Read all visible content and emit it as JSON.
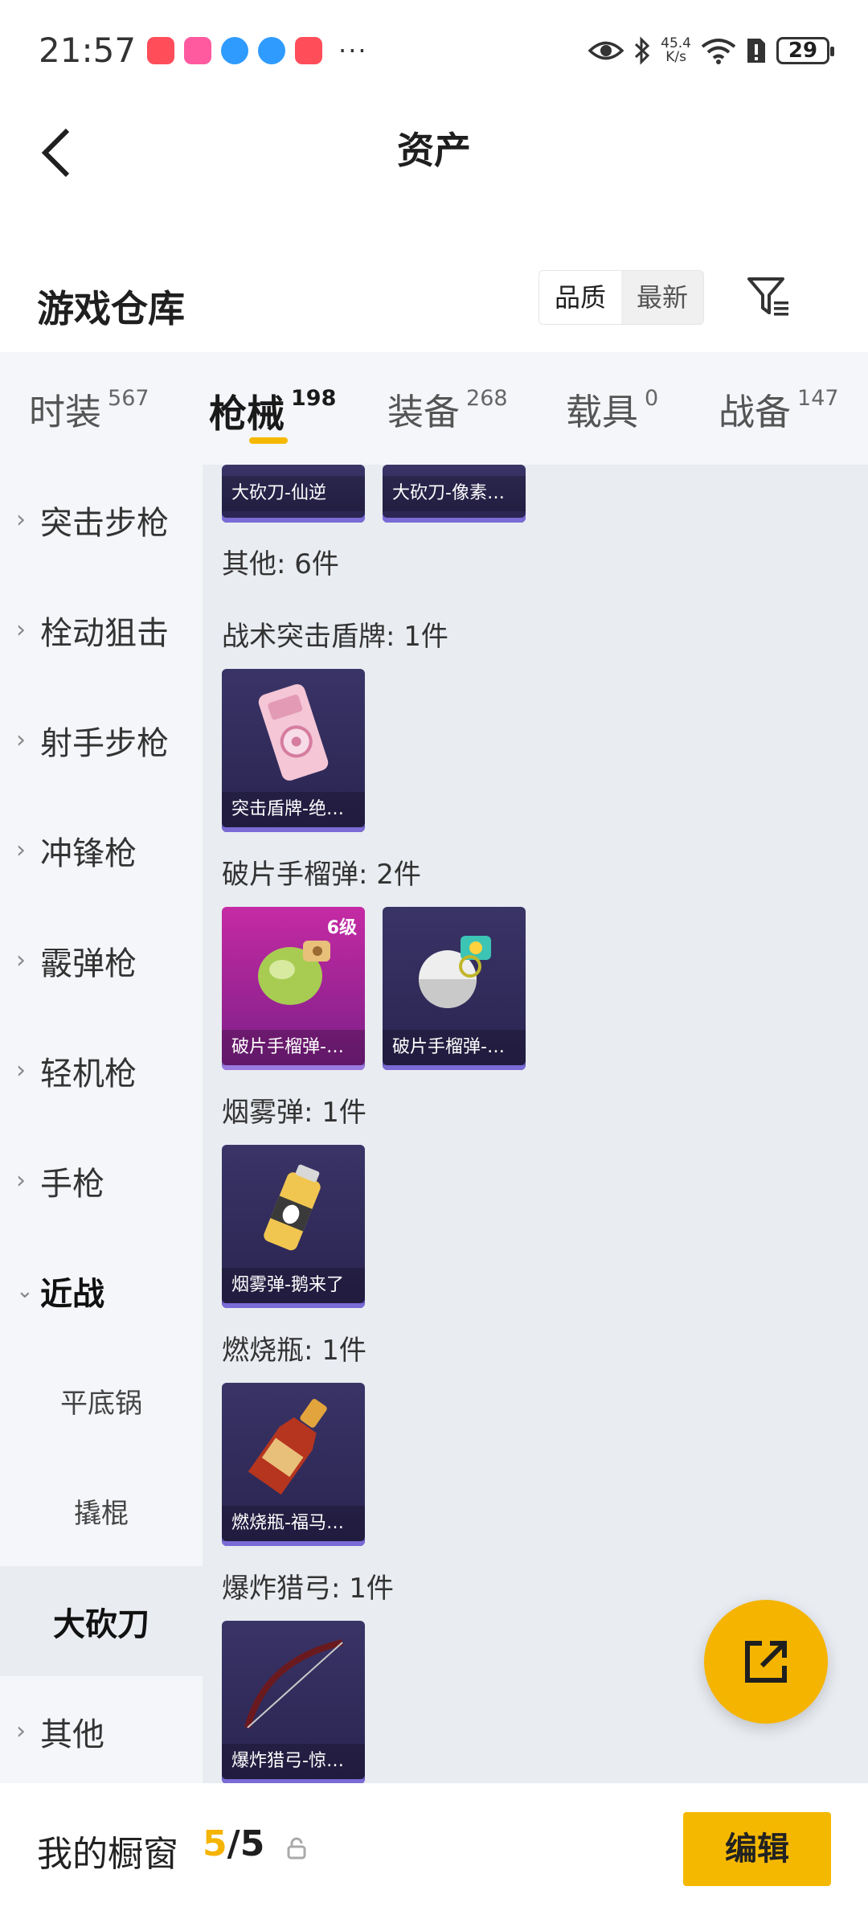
{
  "status_bar": {
    "time": "21:57",
    "net_speed_value": "45.4",
    "net_speed_unit": "K/s",
    "battery": "29"
  },
  "header": {
    "title": "资产"
  },
  "warehouse": {
    "title": "游戏仓库",
    "sort_options": [
      "品质",
      "最新"
    ],
    "sort_selected": "品质"
  },
  "tabs": [
    {
      "label": "时装",
      "count": "567"
    },
    {
      "label": "枪械",
      "count": "198",
      "active": true
    },
    {
      "label": "装备",
      "count": "268"
    },
    {
      "label": "载具",
      "count": "0"
    },
    {
      "label": "战备",
      "count": "147"
    }
  ],
  "sidebar": {
    "items": [
      "突击步枪",
      "栓动狙击",
      "射手步枪",
      "冲锋枪",
      "霰弹枪",
      "轻机枪",
      "手枪",
      "近战"
    ],
    "sub_items": [
      "平底锅",
      "撬棍",
      "大砍刀"
    ],
    "selected": "大砍刀",
    "last_item": "其他"
  },
  "main": {
    "top_cards": [
      "大砍刀-仙逆",
      "大砍刀-像素…"
    ],
    "other_label": "其他: 6件",
    "sections": [
      {
        "label": "战术突击盾牌: 1件",
        "cards": [
          {
            "name": "突击盾牌-绝…"
          }
        ]
      },
      {
        "label": "破片手榴弹: 2件",
        "cards": [
          {
            "name": "破片手榴弹-…",
            "level": "6级"
          },
          {
            "name": "破片手榴弹-…"
          }
        ]
      },
      {
        "label": "烟雾弹: 1件",
        "cards": [
          {
            "name": "烟雾弹-鹅来了"
          }
        ]
      },
      {
        "label": "燃烧瓶: 1件",
        "cards": [
          {
            "name": "燃烧瓶-福马…"
          }
        ]
      },
      {
        "label": "爆炸猎弓: 1件",
        "cards": [
          {
            "name": "爆炸猎弓-惊…"
          }
        ]
      }
    ]
  },
  "bottom_bar": {
    "label": "我的橱窗",
    "count_current": "5",
    "count_sep": "/",
    "count_total": "5",
    "edit_label": "编辑"
  },
  "colors": {
    "accent": "#f5b800",
    "card_purple": "#2f2a5a",
    "card_pink": "#b62a9c"
  }
}
